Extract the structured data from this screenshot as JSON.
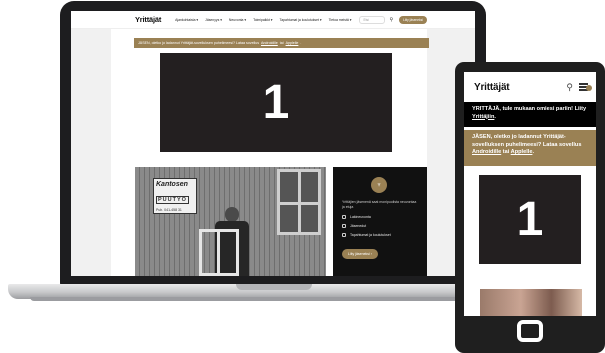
{
  "desktop": {
    "logo": "Yrittäjät",
    "nav": [
      "Ajankohtaista ▾",
      "Jäsenyys ▾",
      "Neuvonta ▾",
      "Toimipaikkt ▾",
      "Tapahtumat ja koulutukset ▾",
      "Tietoa meistä ▾"
    ],
    "search_placeholder": "Etsi",
    "join_button": "Liity jäseneksi",
    "banner": {
      "text_before": "JÄSEN, oletko jo ladannut Yrittäjät-sovelluksen puhelimeesi? Lataa sovellus",
      "android": "Androidille",
      "between": "tai",
      "apple": "Applelle",
      "end": "."
    },
    "video_number": "1",
    "photo_sign": {
      "title": "Kantosen",
      "subtitle": "PUUTYÖ",
      "phone": "Puh. 041-458 31"
    },
    "side_panel": {
      "intro": "Yrittäjien jäsenenä saat monipuolista neuvontaa ja etuja",
      "items": [
        "Lakineuvonta",
        "Jäsenedut",
        "Tapahtumat ja koulutukset"
      ],
      "button": "Liity jäseneksi ›"
    }
  },
  "mobile": {
    "logo": "Yrittäjät",
    "join_text": "YRITTÄJÄ, tule mukaan omiesi pariin! Liity",
    "join_link": "Yrittäjiin",
    "join_end": ".",
    "member_text": "JÄSEN, oletko jo ladannut Yrittäjät-sovelluksen puhelimeesi? Lataa sovellus",
    "android": "Androidille",
    "between": "tai",
    "apple": "Applelle",
    "member_end": ".",
    "video_number": "1"
  },
  "colors": {
    "brand_gold": "#9a8154",
    "dark": "#231f20"
  }
}
